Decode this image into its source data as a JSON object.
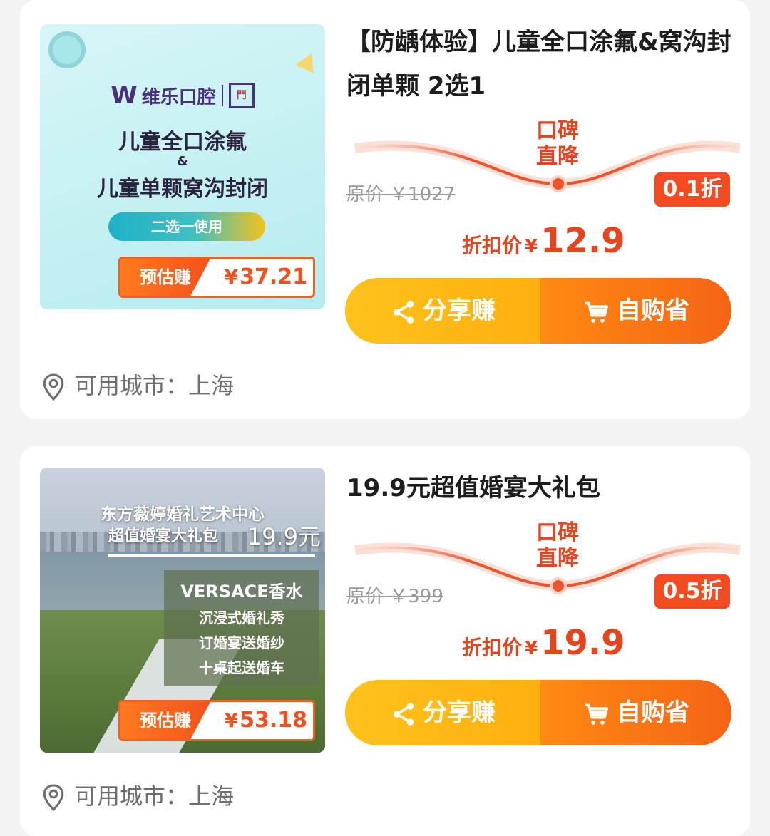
{
  "products": [
    {
      "thumb": {
        "brand": "维乐口腔",
        "line1": "儿童全口涂氟",
        "amp": "&",
        "line2": "儿童单颗窝沟封闭",
        "pill": "二选一使用",
        "earn_label": "预估赚",
        "earn_value": "37.21"
      },
      "title": "【防龋体验】儿童全口涂氟&窝沟封闭单颗 2选1",
      "wave_top": "口碑",
      "wave_bottom": "直降",
      "original_price": "原价 ￥1027",
      "discount_badge": "0.1折",
      "final_label": "折扣价",
      "final_price": "12.9",
      "share_label": "分享赚",
      "buy_label": "自购省",
      "city": "可用城市：上海"
    },
    {
      "thumb": {
        "line1": "东方薇婷婚礼艺术中心",
        "sub": "超值婚宴大礼包",
        "price": "19.9元",
        "box_title": "VERSACE香水",
        "box_line1": "沉浸式婚礼秀",
        "box_line2": "订婚宴送婚纱",
        "box_line3": "十桌起送婚车",
        "earn_label": "预估赚",
        "earn_value": "53.18"
      },
      "title": "19.9元超值婚宴大礼包",
      "wave_top": "口碑",
      "wave_bottom": "直降",
      "original_price": "原价 ￥399",
      "discount_badge": "0.5折",
      "final_label": "折扣价",
      "final_price": "19.9",
      "share_label": "分享赚",
      "buy_label": "自购省",
      "city": "可用城市：上海"
    }
  ],
  "colors": {
    "accent": "#f44a1f",
    "share_button": "#ffb010",
    "buy_button": "#f56415",
    "muted_text": "#9a9a9a"
  },
  "icons": [
    "share-icon",
    "cart-icon",
    "location-pin-icon"
  ]
}
